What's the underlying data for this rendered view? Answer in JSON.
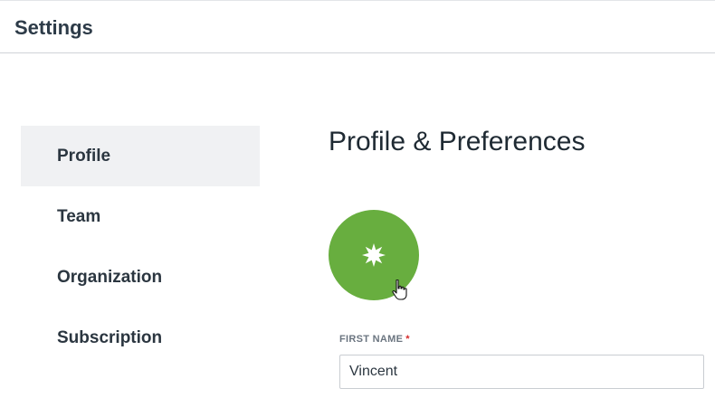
{
  "header": {
    "title": "Settings"
  },
  "sidebar": {
    "items": [
      {
        "label": "Profile",
        "active": true
      },
      {
        "label": "Team",
        "active": false
      },
      {
        "label": "Organization",
        "active": false
      },
      {
        "label": "Subscription",
        "active": false
      }
    ]
  },
  "main": {
    "title": "Profile & Preferences",
    "avatar": {
      "icon": "starburst-icon",
      "color": "#68ae3f"
    },
    "first_name": {
      "label": "FIRST NAME",
      "required_mark": "*",
      "value": "Vincent"
    }
  },
  "colors": {
    "avatar_green": "#68ae3f",
    "required_red": "#d62b2b",
    "active_bg": "#f0f1f3"
  }
}
